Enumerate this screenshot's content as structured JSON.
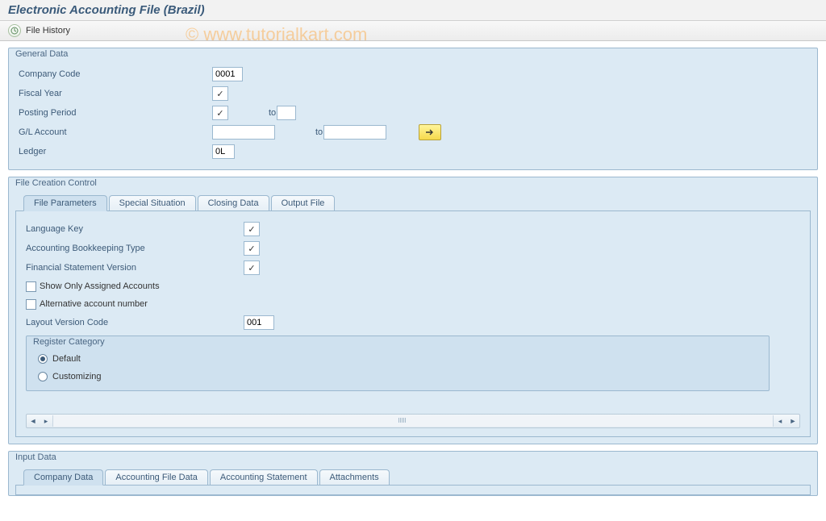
{
  "watermark": "© www.tutorialkart.com",
  "title": "Electronic Accounting File (Brazil)",
  "toolbar": {
    "file_history": "File History"
  },
  "general_data": {
    "legend": "General Data",
    "company_code_label": "Company Code",
    "company_code_value": "0001",
    "fiscal_year_label": "Fiscal Year",
    "posting_period_label": "Posting Period",
    "to_label": "to",
    "gl_account_label": "G/L Account",
    "ledger_label": "Ledger",
    "ledger_value": "0L"
  },
  "fcc": {
    "legend": "File Creation Control",
    "tabs": [
      "File Parameters",
      "Special Situation",
      "Closing Data",
      "Output File"
    ],
    "language_key_label": "Language Key",
    "acct_book_type_label": "Accounting Bookkeeping Type",
    "fin_stmt_ver_label": "Financial Statement Version",
    "show_only_assigned_label": "Show Only Assigned Accounts",
    "alt_acct_num_label": "Alternative account number",
    "layout_version_label": "Layout Version Code",
    "layout_version_value": "001",
    "register_category": {
      "legend": "Register Category",
      "default_label": "Default",
      "customizing_label": "Customizing"
    }
  },
  "input_data": {
    "legend": "Input Data",
    "tabs": [
      "Company Data",
      "Accounting File Data",
      "Accounting Statement",
      "Attachments"
    ]
  }
}
